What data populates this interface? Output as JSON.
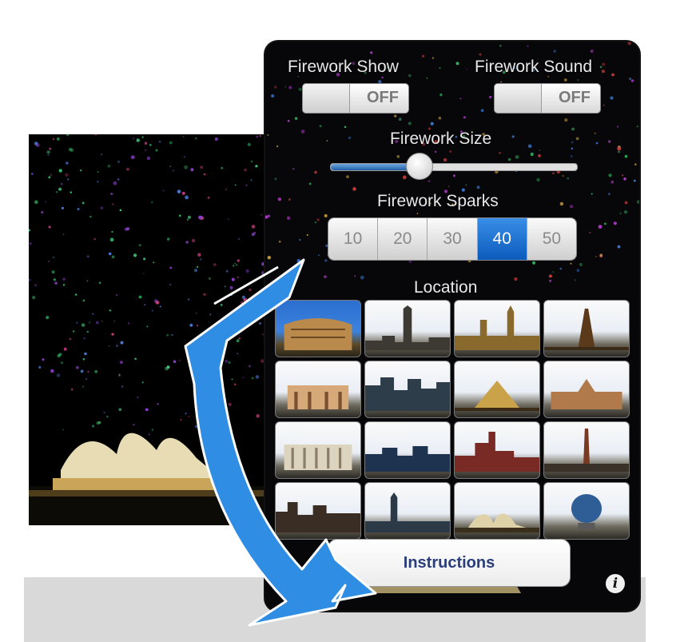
{
  "controls": {
    "show_label": "Firework Show",
    "show_state": "OFF",
    "sound_label": "Firework Sound",
    "sound_state": "OFF",
    "size_label": "Firework Size",
    "size_value": 0.36,
    "sparks_label": "Firework Sparks",
    "spark_options": [
      "10",
      "20",
      "30",
      "40",
      "50"
    ],
    "spark_selected": "40",
    "location_label": "Location",
    "location_selected_index": 0,
    "instructions_label": "Instructions",
    "info_icon": "info-icon"
  },
  "colors": {
    "accent": "#0b5bbd",
    "arrow": "#2f8de4",
    "text_light": "#e8e8e8",
    "instructions_text": "#2a3e7c"
  },
  "icons": [
    "info-icon",
    "curved-arrow-icon"
  ],
  "location_thumbnails": [
    "colosseum",
    "skyline-tower",
    "london-parliament",
    "eiffel-tower",
    "brandenburg-gate",
    "city-skyline",
    "louvre-pyramid",
    "palace-building",
    "lincoln-memorial",
    "city-waterfront",
    "downtown-skyline",
    "spire-tower",
    "skyline-night",
    "minaret-city",
    "sydney-opera-house",
    "globe-monument"
  ]
}
